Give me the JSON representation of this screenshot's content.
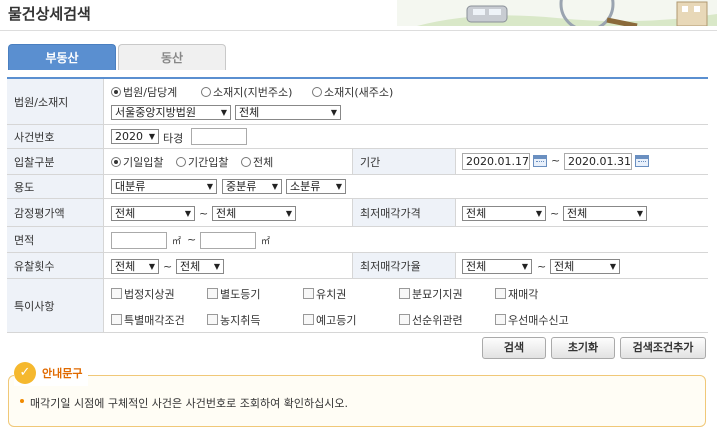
{
  "page_title": "물건상세검색",
  "tabs": [
    {
      "label": "부동산",
      "active": true
    },
    {
      "label": "동산",
      "active": false
    }
  ],
  "rows": {
    "court": {
      "label": "법원/소재지",
      "radios": [
        "법원/담당계",
        "소재지(지번주소)",
        "소재지(새주소)"
      ],
      "selected_radio": 0,
      "court_select": "서울중앙지방법원",
      "dept_select": "전체"
    },
    "case_no": {
      "label": "사건번호",
      "year_select": "2020",
      "type_text": "타경",
      "number_value": ""
    },
    "bid_type": {
      "label": "입찰구분",
      "radios": [
        "기일입찰",
        "기간입찰",
        "전체"
      ],
      "selected_radio": 0,
      "period_label": "기간",
      "date_from": "2020.01.17",
      "tilde": "~",
      "date_to": "2020.01.31"
    },
    "usage": {
      "label": "용도",
      "selects": [
        "대분류",
        "중분류",
        "소분류"
      ]
    },
    "appraisal": {
      "label": "감정평가액",
      "from": "전체",
      "tilde": "~",
      "to": "전체",
      "min_price_label": "최저매각가격",
      "min_from": "전체",
      "min_to": "전체"
    },
    "area": {
      "label": "면적",
      "unit": "㎡",
      "tilde": "~",
      "from_value": "",
      "to_value": ""
    },
    "fail_count": {
      "label": "유찰횟수",
      "from": "전체",
      "tilde": "~",
      "to": "전체",
      "min_rate_label": "최저매각가율",
      "rate_from": "전체",
      "rate_to": "전체"
    },
    "special": {
      "label": "특이사항",
      "checkboxes_row1": [
        "법정지상권",
        "별도등기",
        "유치권",
        "분묘기지권",
        "재매각"
      ],
      "checkboxes_row2": [
        "특별매각조건",
        "농지취득",
        "예고등기",
        "선순위관련",
        "우선매수신고"
      ]
    }
  },
  "buttons": {
    "search": "검색",
    "reset": "초기화",
    "add_condition": "검색조건추가"
  },
  "notice": {
    "title": "안내문구",
    "icon_glyph": "✓",
    "text": "매각기일 시점에 구체적인 사건은 사건번호로 조회하여 확인하십시오."
  },
  "colors": {
    "accent": "#5a8fd0",
    "label_bg": "#eef2f8",
    "notice_border": "#f0c878",
    "notice_title": "#e06a00"
  }
}
